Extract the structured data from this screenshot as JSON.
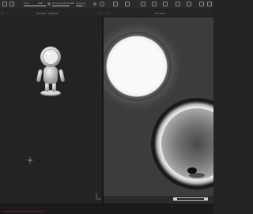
{
  "toolbar": {
    "items": [
      {
        "label": "Flow",
        "value": "100"
      },
      {
        "label": "Stroke opacity",
        "value": "100"
      },
      {
        "label": "Spacing",
        "value": ""
      }
    ]
  },
  "panels": {
    "left_title": "3D View - Material",
    "right_title": "2D View"
  },
  "status": {
    "text": ""
  },
  "colors": {
    "background": "#232323",
    "viewport2d": "#3c3c3c",
    "accent_error": "#c0392b"
  }
}
